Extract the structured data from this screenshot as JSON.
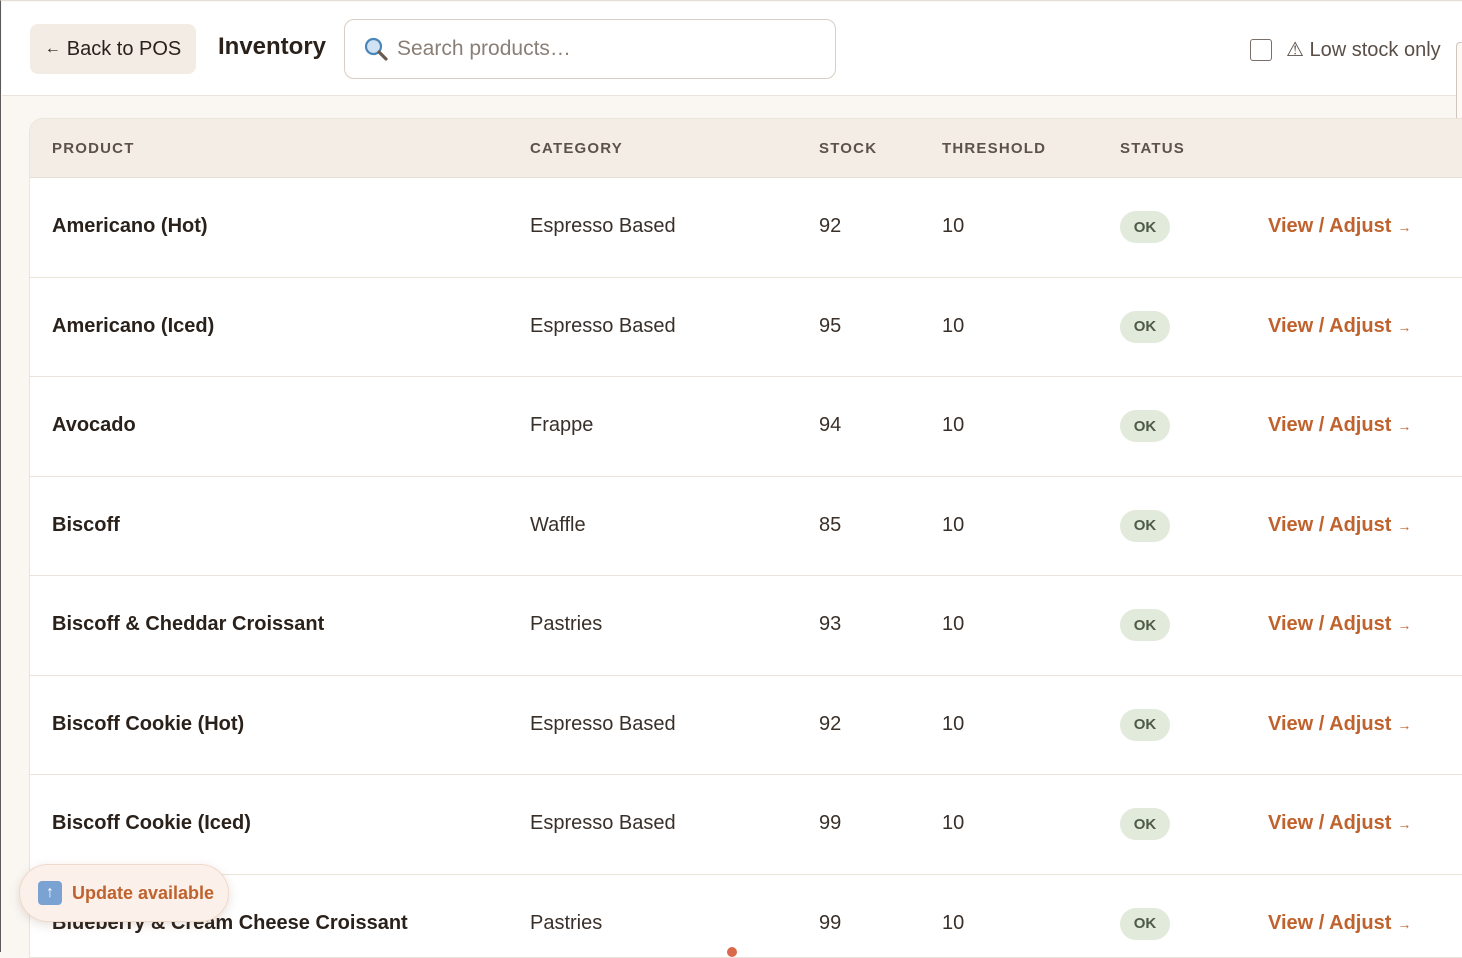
{
  "header": {
    "back_label": "Back to POS",
    "back_arrow": "←",
    "title": "Inventory",
    "search_placeholder": "Search products…",
    "search_value": "",
    "low_stock_checked": false,
    "low_stock_label": "⚠ Low stock only"
  },
  "table": {
    "columns": [
      "PRODUCT",
      "CATEGORY",
      "STOCK",
      "THRESHOLD",
      "STATUS"
    ],
    "action_label": "View / Adjust",
    "action_arrow": "→",
    "rows": [
      {
        "product": "Americano (Hot)",
        "category": "Espresso Based",
        "stock": "92",
        "threshold": "10",
        "status": "OK"
      },
      {
        "product": "Americano (Iced)",
        "category": "Espresso Based",
        "stock": "95",
        "threshold": "10",
        "status": "OK"
      },
      {
        "product": "Avocado",
        "category": "Frappe",
        "stock": "94",
        "threshold": "10",
        "status": "OK"
      },
      {
        "product": "Biscoff",
        "category": "Waffle",
        "stock": "85",
        "threshold": "10",
        "status": "OK"
      },
      {
        "product": "Biscoff & Cheddar Croissant",
        "category": "Pastries",
        "stock": "93",
        "threshold": "10",
        "status": "OK"
      },
      {
        "product": "Biscoff Cookie (Hot)",
        "category": "Espresso Based",
        "stock": "92",
        "threshold": "10",
        "status": "OK"
      },
      {
        "product": "Biscoff Cookie (Iced)",
        "category": "Espresso Based",
        "stock": "99",
        "threshold": "10",
        "status": "OK"
      },
      {
        "product": "Blueberry & Cream Cheese Croissant",
        "category": "Pastries",
        "stock": "99",
        "threshold": "10",
        "status": "OK"
      }
    ]
  },
  "toast": {
    "icon": "up-arrow-icon",
    "label": "Update available"
  },
  "colors": {
    "accent": "#c0622d",
    "badge_ok_bg": "#e2eadb",
    "header_bg": "#f4ede6"
  }
}
